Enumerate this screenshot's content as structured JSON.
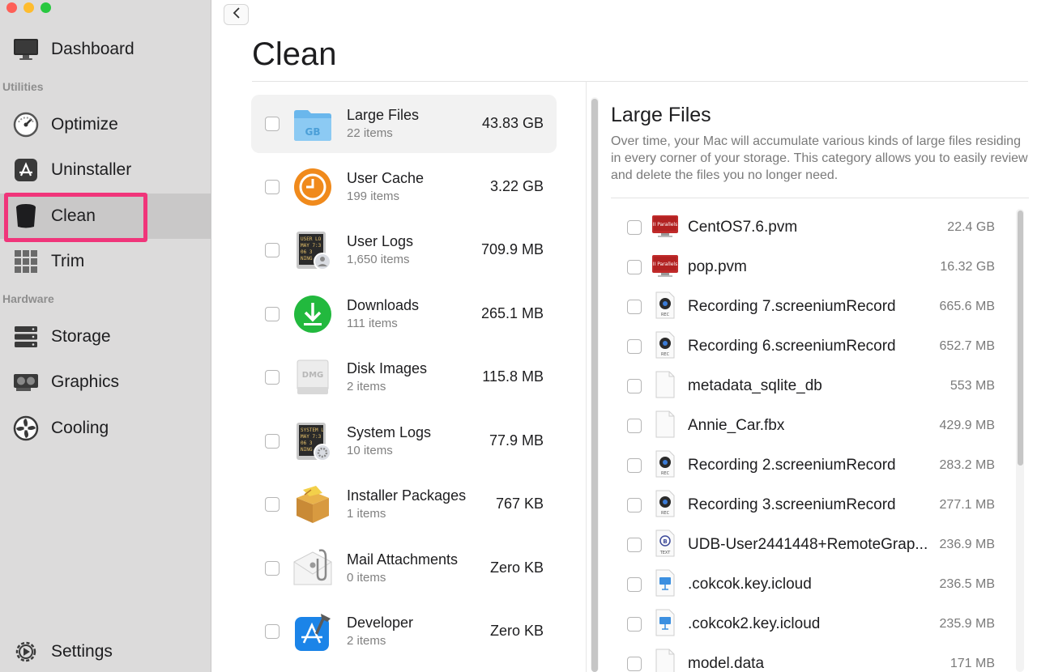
{
  "sidebar": {
    "dashboard": "Dashboard",
    "utilities_label": "Utilities",
    "optimize": "Optimize",
    "uninstaller": "Uninstaller",
    "clean": "Clean",
    "trim": "Trim",
    "hardware_label": "Hardware",
    "storage": "Storage",
    "graphics": "Graphics",
    "cooling": "Cooling",
    "settings": "Settings"
  },
  "page": {
    "title": "Clean"
  },
  "categories": [
    {
      "name": "Large Files",
      "count": "22 items",
      "size": "43.83 GB",
      "icon": "folder-gb-icon"
    },
    {
      "name": "User Cache",
      "count": "199 items",
      "size": "3.22 GB",
      "icon": "clock-icon"
    },
    {
      "name": "User Logs",
      "count": "1,650 items",
      "size": "709.9 MB",
      "icon": "log-user-icon"
    },
    {
      "name": "Downloads",
      "count": "111 items",
      "size": "265.1 MB",
      "icon": "download-icon"
    },
    {
      "name": "Disk Images",
      "count": "2 items",
      "size": "115.8 MB",
      "icon": "dmg-icon"
    },
    {
      "name": "System Logs",
      "count": "10 items",
      "size": "77.9 MB",
      "icon": "log-gear-icon"
    },
    {
      "name": "Installer Packages",
      "count": "1 items",
      "size": "767 KB",
      "icon": "package-icon"
    },
    {
      "name": "Mail Attachments",
      "count": "0 items",
      "size": "Zero KB",
      "icon": "mail-attachment-icon"
    },
    {
      "name": "Developer",
      "count": "2 items",
      "size": "Zero KB",
      "icon": "xcode-icon"
    }
  ],
  "detail": {
    "title": "Large Files",
    "description": "Over time, your Mac will accumulate various kinds of large files residing in every corner of your storage. This category allows you to easily review and delete the files you no longer need."
  },
  "files": [
    {
      "name": "CentOS7.6.pvm",
      "size": "22.4 GB",
      "icon": "parallels-icon"
    },
    {
      "name": "pop.pvm",
      "size": "16.32 GB",
      "icon": "parallels-icon"
    },
    {
      "name": "Recording 7.screeniumRecord",
      "size": "665.6 MB",
      "icon": "rec-icon"
    },
    {
      "name": "Recording 6.screeniumRecord",
      "size": "652.7 MB",
      "icon": "rec-icon"
    },
    {
      "name": "metadata_sqlite_db",
      "size": "553 MB",
      "icon": "blank-file-icon"
    },
    {
      "name": "Annie_Car.fbx",
      "size": "429.9 MB",
      "icon": "blank-file-icon"
    },
    {
      "name": "Recording 2.screeniumRecord",
      "size": "283.2 MB",
      "icon": "rec-icon"
    },
    {
      "name": "Recording 3.screeniumRecord",
      "size": "277.1 MB",
      "icon": "rec-icon"
    },
    {
      "name": "UDB-User2441448+RemoteGrap...",
      "size": "236.9 MB",
      "icon": "text-file-icon"
    },
    {
      "name": ".cokcok.key.icloud",
      "size": "236.5 MB",
      "icon": "keynote-icon"
    },
    {
      "name": ".cokcok2.key.icloud",
      "size": "235.9 MB",
      "icon": "keynote-icon"
    },
    {
      "name": "model.data",
      "size": "171 MB",
      "icon": "blank-file-icon"
    }
  ],
  "colors": {
    "highlight": "#f0357a",
    "sidebar_bg": "#dcdbdb"
  }
}
